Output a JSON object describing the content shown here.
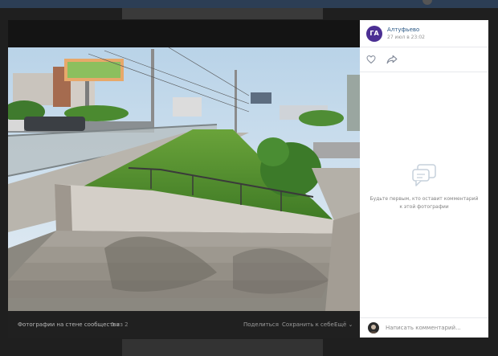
{
  "viewer": {
    "album_title": "Фотографии на стене сообщества",
    "counter": "1 из 2",
    "share_label": "Поделиться",
    "save_label": "Сохранить к себе",
    "more_label": "Ещё ⌄"
  },
  "post": {
    "avatar_initials": "ГА",
    "author": "Алтуфьево",
    "date": "27 июл в 23:02",
    "empty_comments": "Будьте первым, кто оставит комментарий к этой фотографии",
    "comment_placeholder": "Написать комментарий..."
  },
  "icons": {
    "like": "heart-icon",
    "share": "share-arrow-icon",
    "empty": "comment-bubble-icon"
  },
  "colors": {
    "accent_link": "#2a5885",
    "avatar_bg": "#4b2f93",
    "viewer_bar": "#202020"
  }
}
